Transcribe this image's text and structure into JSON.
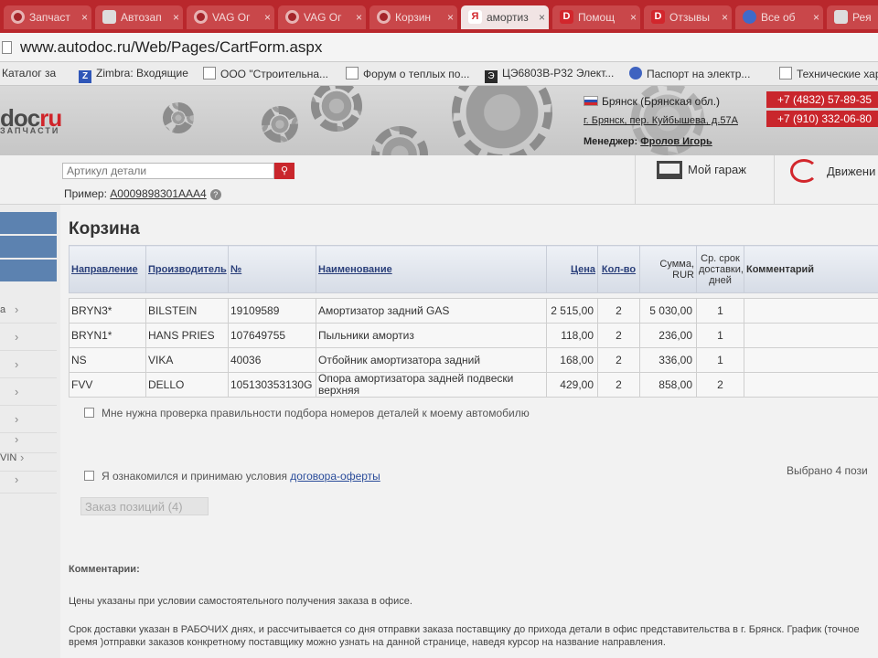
{
  "browser": {
    "tabs": [
      {
        "label": "Запчаст",
        "icon": "gear-icon"
      },
      {
        "label": "Автозап",
        "icon": "page-icon"
      },
      {
        "label": "VAG Ог",
        "icon": "gear-icon"
      },
      {
        "label": "VAG Ог",
        "icon": "gear-icon"
      },
      {
        "label": "Корзин",
        "icon": "gear-icon"
      },
      {
        "label": "амортиз",
        "icon": "yandex-icon"
      },
      {
        "label": "Помощ",
        "icon": "d-icon"
      },
      {
        "label": "Отзывы",
        "icon": "d-icon"
      },
      {
        "label": "Все об",
        "icon": "globe-icon"
      },
      {
        "label": "Рея",
        "icon": "page-icon"
      }
    ],
    "close_glyph": "×",
    "url": "www.autodoc.ru/Web/Pages/CartForm.aspx",
    "bookmarks": [
      {
        "label": "Каталог за"
      },
      {
        "label": "Zimbra: Входящие",
        "icon": "zimbra-icon"
      },
      {
        "label": "ООО \"Строительна..."
      },
      {
        "label": "Форум о теплых по..."
      },
      {
        "label": "ЦЭ6803В-Р32 Элект...",
        "icon": "e-icon"
      },
      {
        "label": "Паспорт на электр...",
        "icon": "globe-icon"
      },
      {
        "label": "Технические хар"
      }
    ]
  },
  "site": {
    "logo_main": "doc",
    "logo_accent": "ru",
    "logo_sub": "ЗАПЧАСТИ",
    "region": "Брянск (Брянская обл.)",
    "address": "г. Брянск, пер. Куйбышева, д.57А",
    "manager_label": "Менеджер:",
    "manager_name": "Фролов Игорь",
    "phones": [
      "+7 (4832) 57-89-35",
      "+7 (910) 332-06-80"
    ]
  },
  "search": {
    "placeholder": "Артикул детали",
    "example_label": "Пример:",
    "example_value": "A0009898301AAA4",
    "garage_label": "Мой гараж",
    "movement_label": "Движени"
  },
  "sidebar": {
    "items": [
      "а",
      "",
      "",
      "",
      "",
      "",
      "VIN",
      ""
    ]
  },
  "cart": {
    "title": "Корзина",
    "columns": {
      "direction": "Направление",
      "manufacturer": "Производитель",
      "number": "№",
      "name": "Наименование",
      "price": "Цена",
      "qty": "Кол-во",
      "sum": "Сумма, RUR",
      "delivery": "Ср. срок доставки, дней",
      "comment": "Комментарий"
    },
    "rows": [
      {
        "direction": "BRYN3*",
        "manufacturer": "BILSTEIN",
        "number": "19109589",
        "name": "Амортизатор задний GAS",
        "price": "2 515,00",
        "qty": "2",
        "sum": "5 030,00",
        "delivery": "1",
        "comment": ""
      },
      {
        "direction": "BRYN1*",
        "manufacturer": "HANS PRIES",
        "number": "107649755",
        "name": "Пыльники амортиз",
        "price": "118,00",
        "qty": "2",
        "sum": "236,00",
        "delivery": "1",
        "comment": ""
      },
      {
        "direction": "NS",
        "manufacturer": "VIKA",
        "number": "40036",
        "name": "Отбойник амортизатора задний",
        "price": "168,00",
        "qty": "2",
        "sum": "336,00",
        "delivery": "1",
        "comment": ""
      },
      {
        "direction": "FVV",
        "manufacturer": "DELLO",
        "number": "105130353130G",
        "name": "Опора амортизатора задней подвески верхняя",
        "price": "429,00",
        "qty": "2",
        "sum": "858,00",
        "delivery": "2",
        "comment": ""
      }
    ],
    "check_verify": "Мне нужна проверка правильности подбора номеров деталей к моему автомобилю",
    "check_terms_prefix": "Я ознакомился и принимаю условия",
    "check_terms_link": "договора-оферты",
    "selected_count": "Выбрано 4 пози",
    "order_button": "Заказ позиций (4)"
  },
  "comments": {
    "title": "Комментарии:",
    "line1": "Цены указаны при условии самостоятельного получения заказа в офисе.",
    "line2": "Срок доставки указан в РАБОЧИХ днях, и рассчитывается со дня отправки заказа поставщику до прихода детали в офис представительства в г. Брянск. График (точное время )отправки заказов конкретному поставщику можно узнать на данной странице, наведя курсор на название направления."
  },
  "colors": {
    "browser_tabbar": "#b9272c",
    "brand_red": "#c9262c",
    "sidebar_blue": "#5c82b0",
    "link_blue": "#2a4c9a"
  }
}
